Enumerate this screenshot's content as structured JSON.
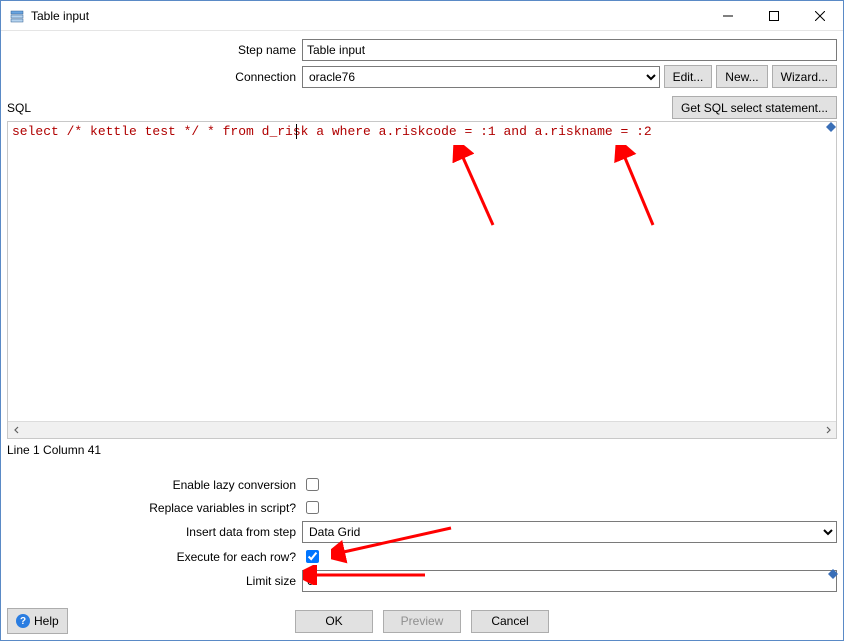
{
  "window": {
    "title": "Table input"
  },
  "form": {
    "step_name_label": "Step name",
    "step_name_value": "Table input",
    "connection_label": "Connection",
    "connection_value": "oracle76",
    "edit_label": "Edit...",
    "new_label": "New...",
    "wizard_label": "Wizard..."
  },
  "sql": {
    "label": "SQL",
    "get_statement_label": "Get SQL select statement...",
    "code": "select /* kettle test */ * from d_risk a where a.riskcode = :1 and a.riskname = :2",
    "status": "Line 1 Column 41"
  },
  "options": {
    "lazy_label": "Enable lazy conversion",
    "lazy_checked": false,
    "replace_label": "Replace variables in script?",
    "replace_checked": false,
    "insert_label": "Insert data from step",
    "insert_value": "Data Grid",
    "each_row_label": "Execute for each row?",
    "each_row_checked": true,
    "limit_label": "Limit size",
    "limit_value": "0"
  },
  "footer": {
    "help_label": "Help",
    "ok_label": "OK",
    "preview_label": "Preview",
    "cancel_label": "Cancel"
  }
}
